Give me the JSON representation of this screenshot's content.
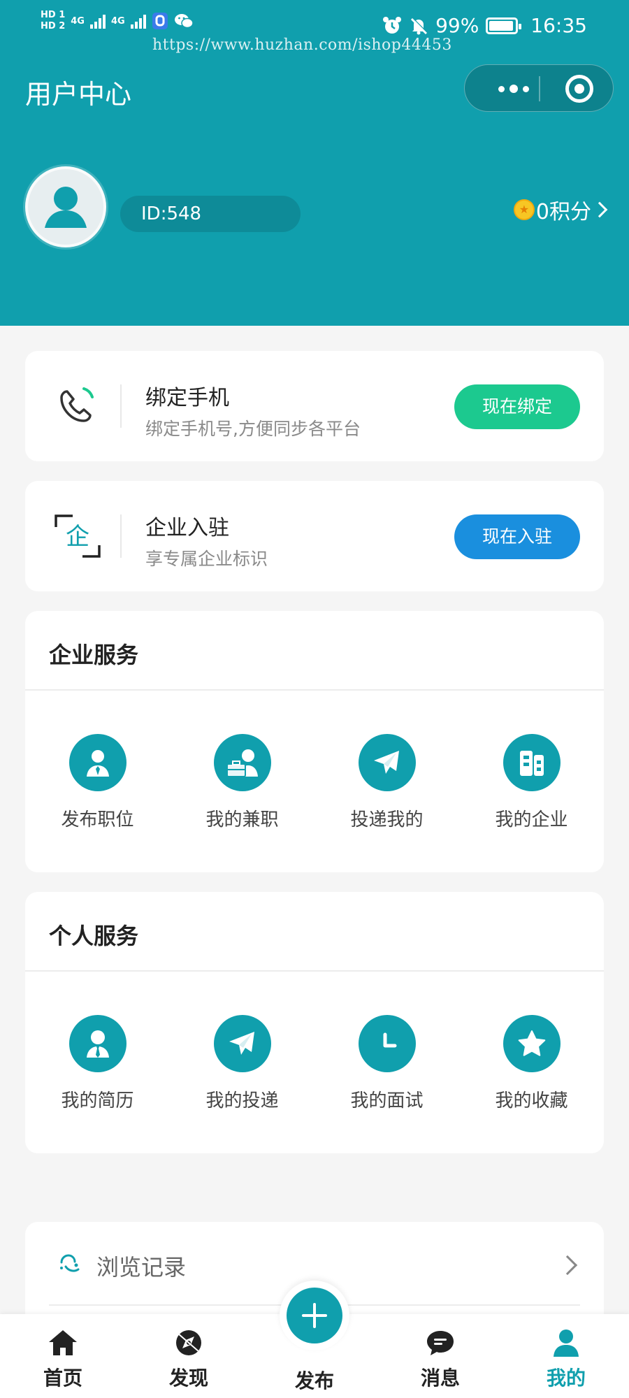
{
  "status_bar": {
    "hd1": "HD 1",
    "hd2": "HD 2",
    "net1": "4G",
    "net2": "4G",
    "battery": "99%",
    "time": "16:35"
  },
  "watermark": "https://www.huzhan.com/ishop44453",
  "header": {
    "title": "用户中心",
    "user_id": "ID:548",
    "points": "0积分"
  },
  "bind_card": {
    "title": "绑定手机",
    "subtitle": "绑定手机号,方便同步各平台",
    "button": "现在绑定",
    "button_color": "#1cc98f"
  },
  "enterprise_card": {
    "icon_text": "企",
    "title": "企业入驻",
    "subtitle": "享专属企业标识",
    "button": "现在入驻",
    "button_color": "#1a8fde"
  },
  "enterprise_services": {
    "title": "企业服务",
    "items": [
      {
        "label": "发布职位",
        "icon": "employee-icon"
      },
      {
        "label": "我的兼职",
        "icon": "briefcase-person-icon"
      },
      {
        "label": "投递我的",
        "icon": "paper-plane-icon"
      },
      {
        "label": "我的企业",
        "icon": "building-icon"
      }
    ]
  },
  "personal_services": {
    "title": "个人服务",
    "items": [
      {
        "label": "我的简历",
        "icon": "resume-person-icon"
      },
      {
        "label": "我的投递",
        "icon": "paper-plane-icon"
      },
      {
        "label": "我的面试",
        "icon": "clock-icon"
      },
      {
        "label": "我的收藏",
        "icon": "star-icon"
      }
    ]
  },
  "history": {
    "label": "浏览记录"
  },
  "tabbar": {
    "items": [
      {
        "label": "首页",
        "icon": "home-icon"
      },
      {
        "label": "发现",
        "icon": "compass-icon"
      },
      {
        "label": "发布",
        "icon": "plus-icon"
      },
      {
        "label": "消息",
        "icon": "chat-icon"
      },
      {
        "label": "我的",
        "icon": "person-icon",
        "active": true
      }
    ]
  },
  "colors": {
    "primary": "#109fad",
    "bind_green": "#1cc98f",
    "enter_blue": "#1a8fde",
    "background": "#f5f5f5"
  }
}
